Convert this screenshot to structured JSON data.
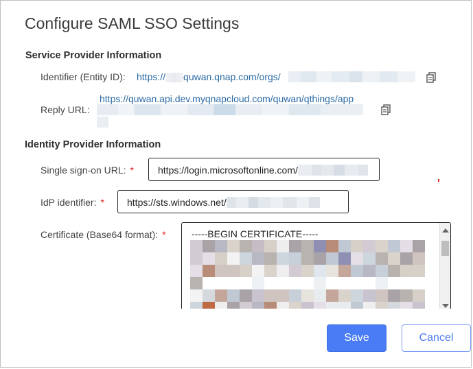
{
  "dialog": {
    "title": "Configure SAML SSO Settings"
  },
  "service_provider": {
    "heading": "Service Provider Information",
    "identifier_label": "Identifier (Entity ID):",
    "identifier_url_prefix": "https://",
    "identifier_url_mid": "quwan.qnap.com/orgs/",
    "reply_label": "Reply URL:",
    "reply_url": "https://quwan.api.dev.myqnapcloud.com/quwan/qthings/app"
  },
  "identity_provider": {
    "heading": "Identity Provider Information",
    "sso_label": "Single sign-on URL:",
    "sso_value": "https://login.microsoftonline.com/",
    "idp_label": "IdP identifier:",
    "idp_value": "https://sts.windows.net/",
    "cert_label": "Certificate (Base64 format):",
    "cert_value": "-----BEGIN CERTIFICATE-----",
    "required_mark": "*"
  },
  "buttons": {
    "save": "Save",
    "cancel": "Cancel"
  },
  "colors": {
    "accent": "#4a7cf5",
    "link": "#2a6aa6",
    "required": "#e02020"
  }
}
